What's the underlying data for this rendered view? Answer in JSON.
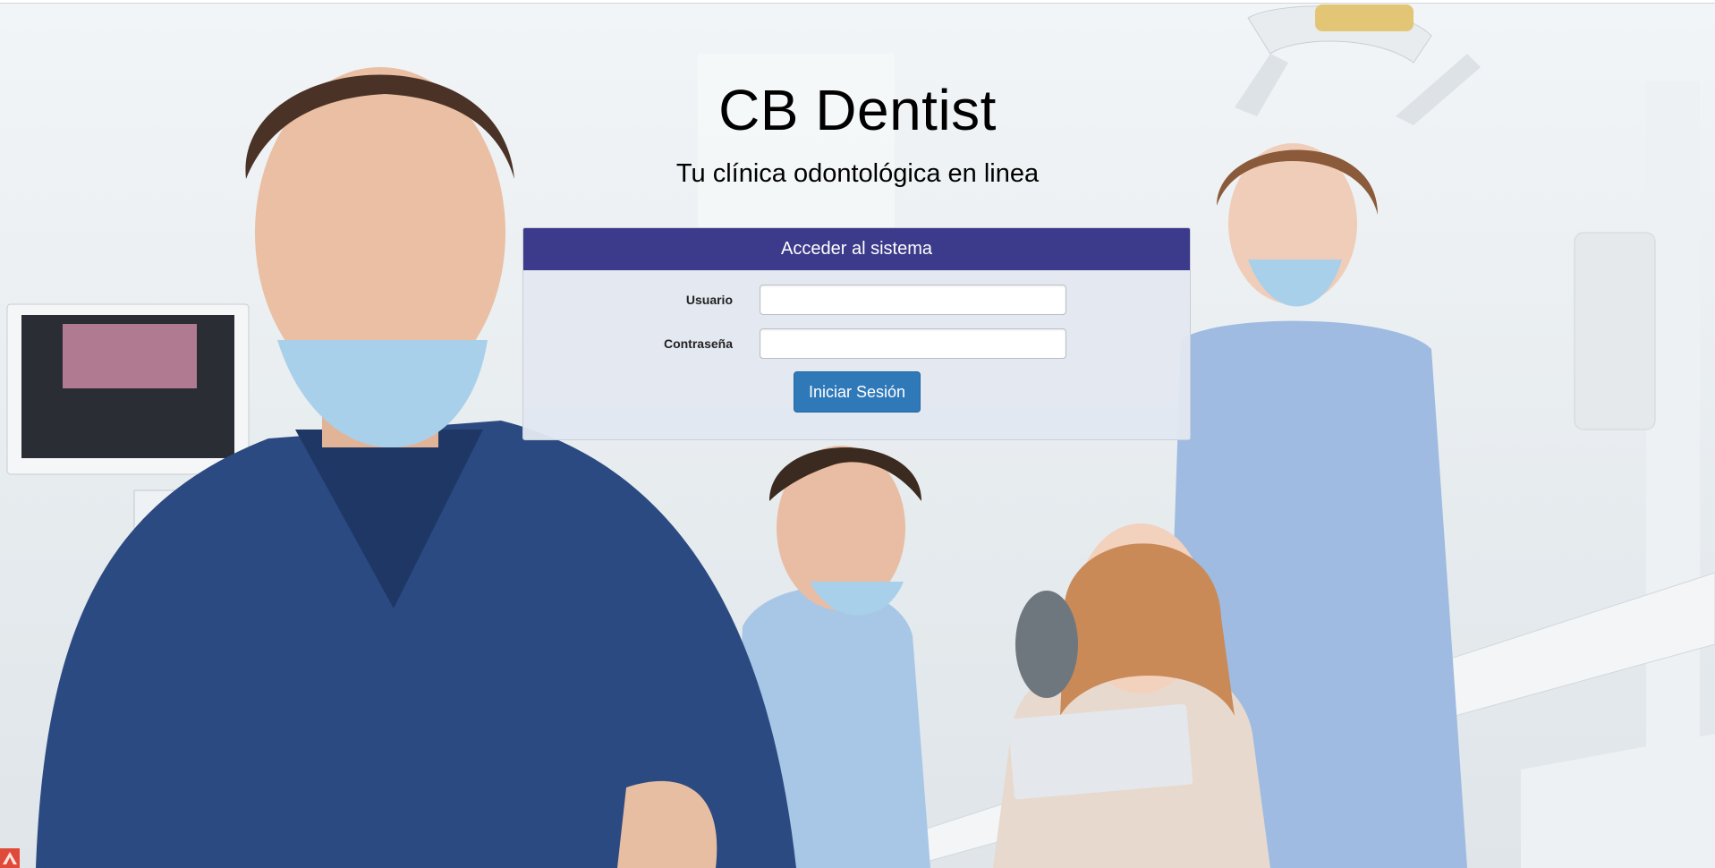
{
  "brand": {
    "title": "CB Dentist",
    "subtitle": "Tu clínica odontológica en linea"
  },
  "login_panel": {
    "heading": "Acceder al sistema",
    "username_label": "Usuario",
    "username_value": "",
    "password_label": "Contraseña",
    "password_value": "",
    "submit_label": "Iniciar Sesión"
  },
  "colors": {
    "panel_heading": "#3c3a8a",
    "button": "#2f79b9",
    "panel_body": "#e2e7f0"
  },
  "icons": {
    "corner": "app-logo-icon"
  }
}
